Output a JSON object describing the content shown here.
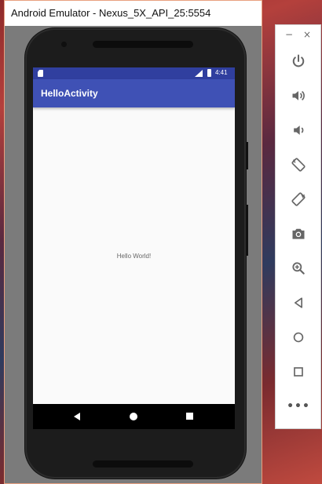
{
  "window": {
    "title": "Android Emulator - Nexus_5X_API_25:5554"
  },
  "device": {
    "status_bar": {
      "time": "4:41"
    },
    "app": {
      "title": "HelloActivity",
      "content_text": "Hello World!"
    },
    "colors": {
      "status_bar": "#303f9f",
      "app_bar": "#3f51b5",
      "screen_bg": "#fafafa"
    },
    "nav_buttons": [
      "back-icon",
      "home-icon",
      "recents-icon"
    ]
  },
  "controls_panel": {
    "window_buttons": {
      "minimize": "−",
      "close": "×"
    },
    "controls": [
      "power-icon",
      "volume-up-icon",
      "volume-down-icon",
      "rotate-left-icon",
      "rotate-right-icon",
      "camera-icon",
      "zoom-icon",
      "back-icon",
      "home-icon",
      "overview-icon"
    ],
    "more_label": "•••"
  }
}
